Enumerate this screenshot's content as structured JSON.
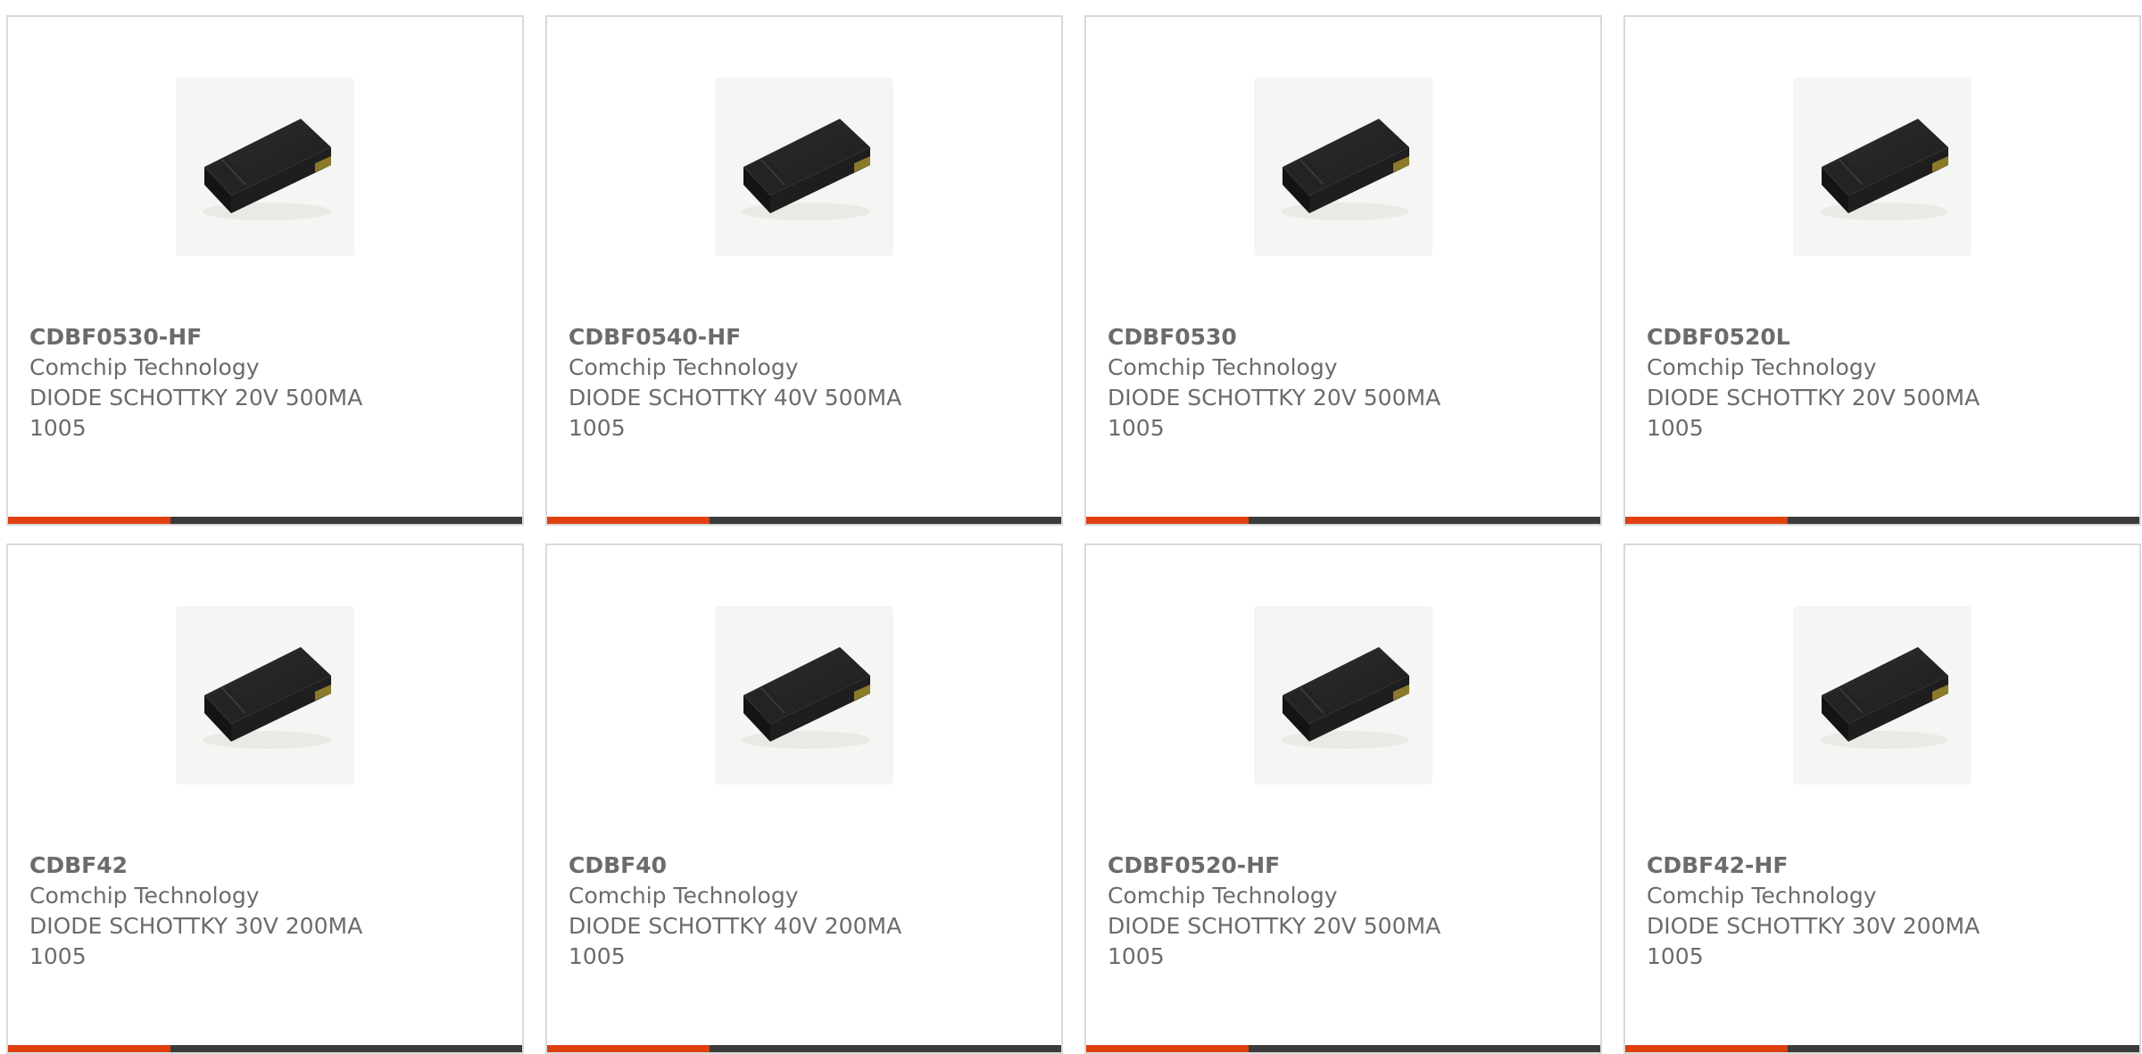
{
  "accent_color": "#e0400f",
  "bar_color": "#3b3b3b",
  "products": [
    {
      "part": "CDBF0530-HF",
      "manufacturer": "Comchip Technology",
      "description": "DIODE SCHOTTKY 20V 500MA",
      "package": "1005",
      "image_icon": "diode-chip-icon"
    },
    {
      "part": "CDBF0540-HF",
      "manufacturer": "Comchip Technology",
      "description": "DIODE SCHOTTKY 40V 500MA",
      "package": "1005",
      "image_icon": "diode-chip-icon"
    },
    {
      "part": "CDBF0530",
      "manufacturer": "Comchip Technology",
      "description": "DIODE SCHOTTKY 20V 500MA",
      "package": "1005",
      "image_icon": "diode-chip-icon"
    },
    {
      "part": "CDBF0520L",
      "manufacturer": "Comchip Technology",
      "description": "DIODE SCHOTTKY 20V 500MA",
      "package": "1005",
      "image_icon": "diode-chip-icon"
    },
    {
      "part": "CDBF42",
      "manufacturer": "Comchip Technology",
      "description": "DIODE SCHOTTKY 30V 200MA",
      "package": "1005",
      "image_icon": "diode-chip-icon"
    },
    {
      "part": "CDBF40",
      "manufacturer": "Comchip Technology",
      "description": "DIODE SCHOTTKY 40V 200MA",
      "package": "1005",
      "image_icon": "diode-chip-icon"
    },
    {
      "part": "CDBF0520-HF",
      "manufacturer": "Comchip Technology",
      "description": "DIODE SCHOTTKY 20V 500MA",
      "package": "1005",
      "image_icon": "diode-chip-icon"
    },
    {
      "part": "CDBF42-HF",
      "manufacturer": "Comchip Technology",
      "description": "DIODE SCHOTTKY 30V 200MA",
      "package": "1005",
      "image_icon": "diode-chip-icon"
    }
  ]
}
